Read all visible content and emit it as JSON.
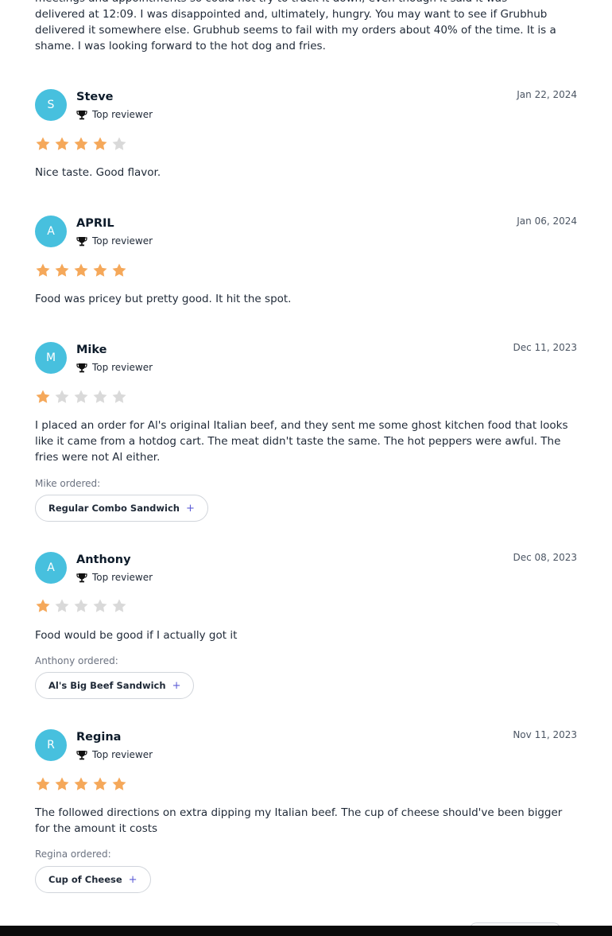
{
  "top_review": {
    "text": "meetings and appointments so could not try to track it down, even though it said it was delivered at 12:09. I was disappointed and, ultimately, hungry. You may want to see if Grubhub delivered it somewhere else. Grubhub seems to fail with my orders about 40% of the time. It is a shame. I was looking forward to the hot dog and fries."
  },
  "badge_label": "Top reviewer",
  "colors": {
    "star_filled": "#f5a85a",
    "star_empty": "#d9d9d9",
    "avatar": "#47c0de",
    "plus": "#5b5bd6"
  },
  "reviews": [
    {
      "initial": "S",
      "name": "Steve",
      "date": "Jan 22, 2024",
      "rating": 4,
      "text": "Nice taste. Good flavor.",
      "ordered_label": "",
      "item": ""
    },
    {
      "initial": "A",
      "name": "APRIL",
      "date": "Jan 06, 2024",
      "rating": 5,
      "text": "Food was pricey but pretty good. It hit the spot.",
      "ordered_label": "",
      "item": ""
    },
    {
      "initial": "M",
      "name": "Mike",
      "date": "Dec 11, 2023",
      "rating": 1,
      "text": "I placed an order for Al's original Italian beef, and they sent me some ghost kitchen food that looks like it came from a hotdog cart. The meat didn't taste the same. The hot peppers were awful. The fries were not Al either.",
      "ordered_label": "Mike ordered:",
      "item": "Regular Combo Sandwich"
    },
    {
      "initial": "A",
      "name": "Anthony",
      "date": "Dec 08, 2023",
      "rating": 1,
      "text": "Food would be good if I actually got it",
      "ordered_label": "Anthony ordered:",
      "item": "Al's Big Beef Sandwich"
    },
    {
      "initial": "R",
      "name": "Regina",
      "date": "Nov 11, 2023",
      "rating": 5,
      "text": "The followed directions on extra dipping my Italian beef. The cup of cheese should've been bigger for the amount it costs",
      "ordered_label": "Regina ordered:",
      "item": "Cup of Cheese"
    }
  ]
}
